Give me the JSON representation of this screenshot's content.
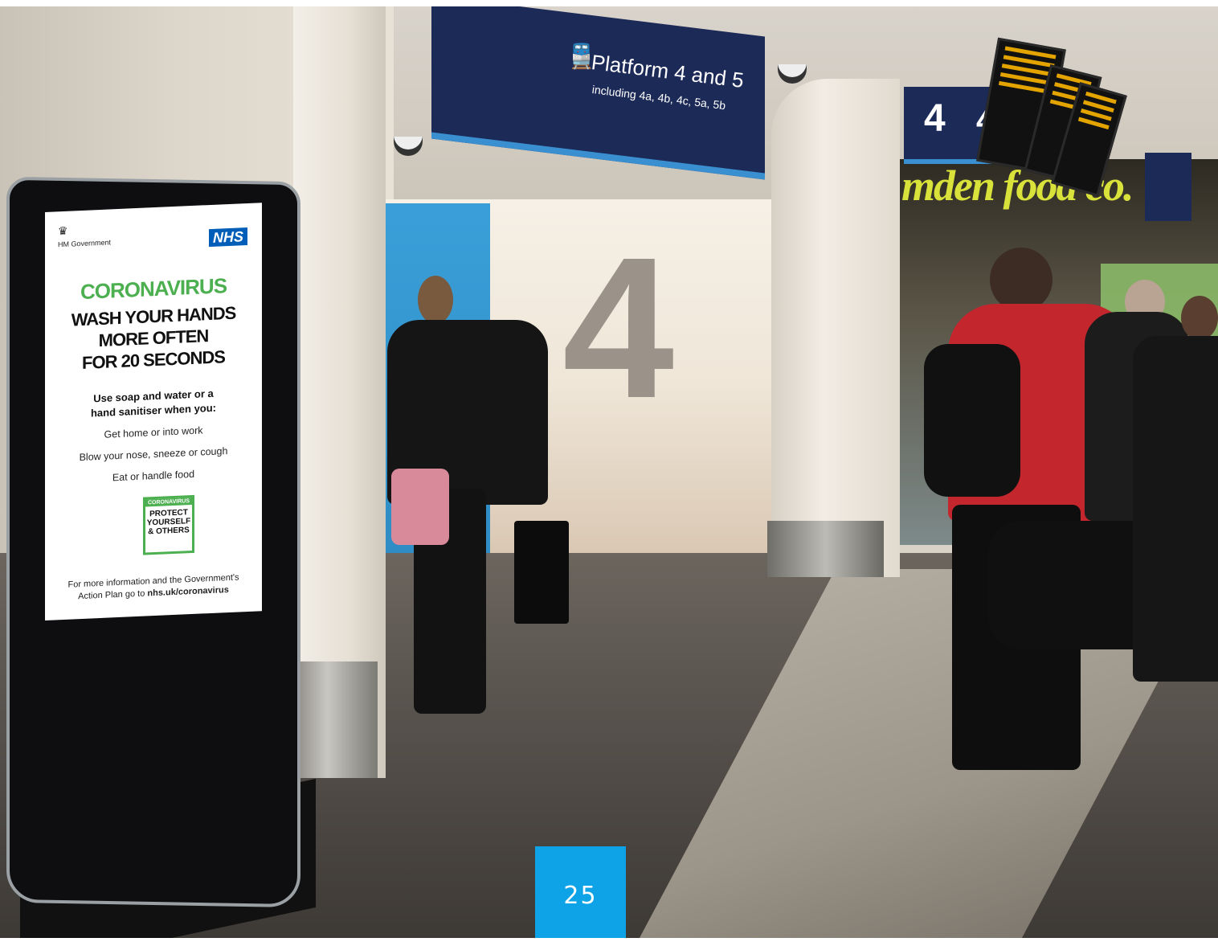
{
  "photo": {
    "overhead_sign": {
      "title": "Platform 4 and 5",
      "subtitle": "including 4a, 4b, 4c, 5a, 5b",
      "icon": "train-icon",
      "bg": "#1c2a57",
      "accent": "#3a8fd0"
    },
    "platform_number_sign": {
      "primary": "4",
      "secondary": "4"
    },
    "wall_number": "4",
    "shop_sign": "mden food co."
  },
  "kiosk_screen": {
    "gov_label": "HM Government",
    "gov_crest": "crest-icon",
    "nhs_logo": "NHS",
    "title": "CORONAVIRUS",
    "headline": [
      "WASH YOUR HANDS",
      "MORE OFTEN",
      "FOR 20 SECONDS"
    ],
    "instruction": [
      "Use soap and water or a",
      "hand sanitiser when you:"
    ],
    "items": [
      "Get home or into work",
      "Blow your nose, sneeze or cough",
      "Eat or handle food"
    ],
    "badge": {
      "top": "CORONAVIRUS",
      "lines": [
        "PROTECT",
        "YOURSELF",
        "& OTHERS"
      ]
    },
    "footer_line1": "For more information and the Government's",
    "footer_line2_prefix": "Action Plan go to ",
    "footer_link": "nhs.uk/coronavirus",
    "colors": {
      "green": "#4caf50",
      "nhs_blue": "#005eb8"
    }
  },
  "page_number": "25",
  "page_badge_color": "#0ea3e6"
}
